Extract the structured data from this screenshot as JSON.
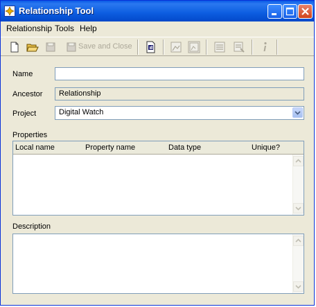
{
  "window": {
    "title": "Relationship Tool"
  },
  "menu": [
    "Relationship",
    "Tools",
    "Help"
  ],
  "toolbar": {
    "save_close_label": "Save and Close"
  },
  "form": {
    "name_label": "Name",
    "name_value": "",
    "ancestor_label": "Ancestor",
    "ancestor_value": "Relationship",
    "project_label": "Project",
    "project_value": "Digital Watch",
    "properties_label": "Properties",
    "properties_columns": [
      "Local name",
      "Property name",
      "Data type",
      "Unique?"
    ],
    "description_label": "Description",
    "description_value": ""
  },
  "colors": {
    "titlebar": "#0a5ae6",
    "face": "#ece9d8",
    "field_border": "#7f9db9",
    "close_button": "#d0441c"
  }
}
